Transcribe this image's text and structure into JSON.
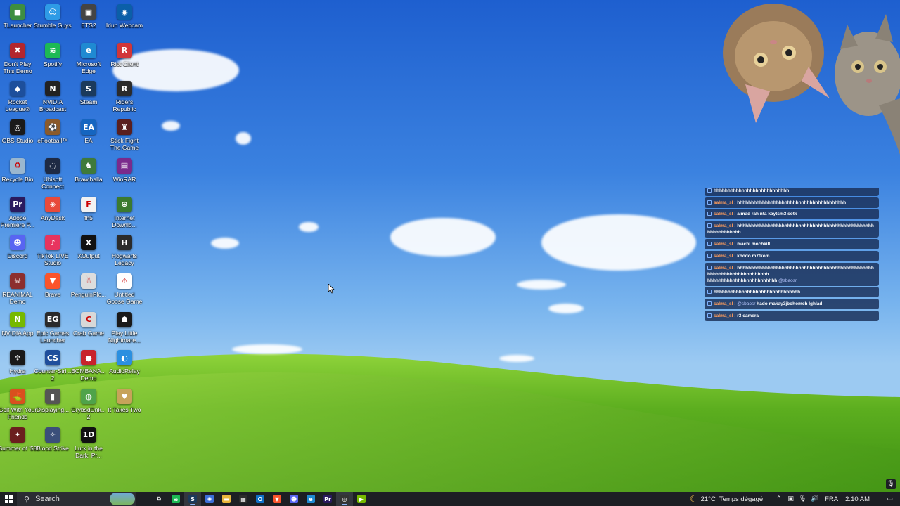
{
  "desktop": {
    "icons": [
      {
        "label": "TLauncher",
        "color": "#3e8e41",
        "glyph": "■"
      },
      {
        "label": "Stumble Guys",
        "color": "#2e9be6",
        "glyph": "☺"
      },
      {
        "label": "ETS2",
        "color": "#444444",
        "glyph": "▣"
      },
      {
        "label": "Iriun Webcam",
        "color": "#0b5fa8",
        "glyph": "◉"
      },
      {
        "label": "Don't Play This Demo",
        "color": "#b3262e",
        "glyph": "✖"
      },
      {
        "label": "Spotify",
        "color": "#1db954",
        "glyph": "≋"
      },
      {
        "label": "Microsoft Edge",
        "color": "#1f8ad2",
        "glyph": "e"
      },
      {
        "label": "Riot Client",
        "color": "#d13639",
        "glyph": "R"
      },
      {
        "label": "Rocket League®",
        "color": "#1d4f9c",
        "glyph": "◆"
      },
      {
        "label": "NVIDIA Broadcast",
        "color": "#222222",
        "glyph": "N"
      },
      {
        "label": "Steam",
        "color": "#1b3a5c",
        "glyph": "S"
      },
      {
        "label": "Riders Republic",
        "color": "#2b2b2b",
        "glyph": "R"
      },
      {
        "label": "OBS Studio",
        "color": "#1a1a1a",
        "glyph": "◎"
      },
      {
        "label": "eFootball™",
        "color": "#8a5a2b",
        "glyph": "⚽"
      },
      {
        "label": "EA",
        "color": "#1565c0",
        "glyph": "EA"
      },
      {
        "label": "Stick Fight The Game",
        "color": "#5a1f1f",
        "glyph": "♜"
      },
      {
        "label": "Recycle Bin",
        "color": "#9ab7cf",
        "glyph": "♻"
      },
      {
        "label": "Ubisoft Connect",
        "color": "#1e2a44",
        "glyph": "◌"
      },
      {
        "label": "Brawlhalla",
        "color": "#3f7a3a",
        "glyph": "♞"
      },
      {
        "label": "WinRAR",
        "color": "#7a2a8c",
        "glyph": "▤"
      },
      {
        "label": "Adobe Premiere P...",
        "color": "#2a1a5e",
        "glyph": "Pr"
      },
      {
        "label": "AnyDesk",
        "color": "#e84a3b",
        "glyph": "◈"
      },
      {
        "label": "fh5",
        "color": "#f2f2f2",
        "glyph": "F"
      },
      {
        "label": "Internet Downlo...",
        "color": "#3b7a2f",
        "glyph": "⊕"
      },
      {
        "label": "Discord",
        "color": "#5865f2",
        "glyph": "☻"
      },
      {
        "label": "TikTok LIVE Studio",
        "color": "#e8345f",
        "glyph": "♪"
      },
      {
        "label": "XOutput",
        "color": "#111111",
        "glyph": "X"
      },
      {
        "label": "Hogwarts Legacy",
        "color": "#2b2b2b",
        "glyph": "H"
      },
      {
        "label": "REANIMAL Demo",
        "color": "#8c2e2e",
        "glyph": "☠"
      },
      {
        "label": "Brave",
        "color": "#fb542b",
        "glyph": "▼"
      },
      {
        "label": "PenguinPlo...",
        "color": "#dddddd",
        "glyph": "☃"
      },
      {
        "label": "Untitled Goose Game",
        "color": "#ffffff",
        "glyph": "⚠"
      },
      {
        "label": "NVIDIA App",
        "color": "#76b900",
        "glyph": "N"
      },
      {
        "label": "Epic Games Launcher",
        "color": "#2a2a2a",
        "glyph": "EG"
      },
      {
        "label": "Crab Game",
        "color": "#d8d8d8",
        "glyph": "C"
      },
      {
        "label": "Play Little Nightmare...",
        "color": "#1a1a1a",
        "glyph": "☗"
      },
      {
        "label": "Hydra",
        "color": "#1a1a1a",
        "glyph": "♆"
      },
      {
        "label": "Counter-Stri... 2",
        "color": "#1f4e9c",
        "glyph": "CS"
      },
      {
        "label": "BOMBANA... Demo",
        "color": "#c8232c",
        "glyph": "●"
      },
      {
        "label": "AudioRelay",
        "color": "#2b8fe0",
        "glyph": "◐"
      },
      {
        "label": "Golf With Your Friends",
        "color": "#d9501e",
        "glyph": "⛳"
      },
      {
        "label": "Displaying...",
        "color": "#555555",
        "glyph": "▮"
      },
      {
        "label": "GrybsdDnk... 2",
        "color": "#4fa34a",
        "glyph": "◍"
      },
      {
        "label": "It Takes Two",
        "color": "#c7a35a",
        "glyph": "♥"
      },
      {
        "label": "Summer of '58",
        "color": "#6b1e1e",
        "glyph": "✦"
      },
      {
        "label": "Blood Strike",
        "color": "#3b4f7a",
        "glyph": "✧"
      },
      {
        "label": "Lurk in the Dark: Pr...",
        "color": "#111111",
        "glyph": "1D"
      }
    ]
  },
  "chat": {
    "messages": [
      {
        "user": "",
        "text": "hhhhhhhhhhhhhhhhhhhhhhhhhhh",
        "mention": ""
      },
      {
        "user": "salma_sl :",
        "text": "hhhhhhhhhhhhhhhhhhhhhhhhhhhhhhhhhhhhhhh",
        "mention": ""
      },
      {
        "user": "salma_sl :",
        "text": "aimad rah nta kaytsm3 sotk",
        "mention": ""
      },
      {
        "user": "salma_sl :",
        "text": "hhhhhhhhhhhhhhhhhhhhhhhhhhhhhhhhhhhhhhhhhhhhhhhhhhhhhhhhhhhhh",
        "mention": ""
      },
      {
        "user": "salma_sl :",
        "text": "machi mochkill",
        "mention": ""
      },
      {
        "user": "salma_sl :",
        "text": "khodo m7tkom",
        "mention": ""
      },
      {
        "user": "salma_sl :",
        "text": "hhhhhhhhhhhhhhhhhhhhhhhhhhhhhhhhhhhhhhhhhhhhhhhhhhhhhhhhhhhhhhhhhhhhhhh",
        "text2": "hhhhhhhhhhhhhhhhhhhhhhhhh",
        "mention": "@sbaosr"
      },
      {
        "user": "",
        "text": "hhhhhhhhhhhhhhhhhhhhhhhhhhhhhhh",
        "mention": ""
      },
      {
        "user": "salma_sl :",
        "text": "hado makay3jbohomch lghlad",
        "mention": "@sbaosr"
      },
      {
        "user": "salma_sl :",
        "text": "r3 camera",
        "mention": ""
      }
    ]
  },
  "taskbar": {
    "search_label": "Search",
    "apps": [
      {
        "name": "task-view",
        "glyph": "⧉",
        "color": "transparent",
        "active": false
      },
      {
        "name": "spotify",
        "glyph": "≋",
        "color": "#1db954",
        "active": false
      },
      {
        "name": "steam",
        "glyph": "S",
        "color": "#1b3a5c",
        "active": true
      },
      {
        "name": "copilot",
        "glyph": "✺",
        "color": "#3c6fd8",
        "active": false
      },
      {
        "name": "file-explorer",
        "glyph": "▬",
        "color": "#e9b73b",
        "active": false
      },
      {
        "name": "store",
        "glyph": "▦",
        "color": "#2c2c2c",
        "active": false
      },
      {
        "name": "outlook",
        "glyph": "O",
        "color": "#1070c8",
        "active": false
      },
      {
        "name": "brave",
        "glyph": "▼",
        "color": "#fb542b",
        "active": false
      },
      {
        "name": "discord",
        "glyph": "☻",
        "color": "#5865f2",
        "active": false
      },
      {
        "name": "edge",
        "glyph": "e",
        "color": "#1f8ad2",
        "active": false
      },
      {
        "name": "premiere",
        "glyph": "Pr",
        "color": "#2a1a5e",
        "active": false
      },
      {
        "name": "obs",
        "glyph": "◎",
        "color": "#333333",
        "active": true
      },
      {
        "name": "nvidia",
        "glyph": "▶",
        "color": "#76b900",
        "active": false
      }
    ],
    "weather": {
      "temp": "21°C",
      "desc": "Temps dégagé"
    },
    "language": "FRA",
    "time": "2:10 AM"
  }
}
